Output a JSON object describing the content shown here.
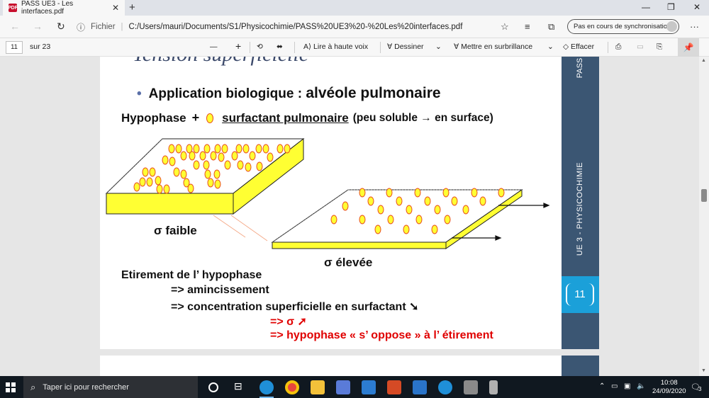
{
  "browser": {
    "tab_title": "PASS UE3 - Les interfaces.pdf",
    "tab_close": "✕",
    "new_tab": "+",
    "window_minimize": "—",
    "window_restore": "❐",
    "window_close": "✕",
    "url_scheme_label": "Fichier",
    "url_path": "C:/Users/mauri/Documents/S1/Physicochimie/PASS%20UE3%20-%20Les%20interfaces.pdf",
    "sync_label": "Pas en cours de synchronisation",
    "more_menu": "···"
  },
  "pdf_toolbar": {
    "current_page": "11",
    "page_total": "sur 23",
    "zoom_out": "—",
    "zoom_in": "+",
    "read_aloud": "Lire à haute voix",
    "draw": "Dessiner",
    "highlight": "Mettre en surbrillance",
    "erase": "Effacer"
  },
  "slide": {
    "title": "Tension superficielle",
    "bullet_prefix": "Application biologique : ",
    "bullet_main": "alvéole pulmonaire",
    "hypophase": "Hypophase",
    "plus": "+",
    "surfactant": "surfactant pulmonaire ",
    "surfactant_note": "(peu soluble → en surface)",
    "sigma_low": "σ faible",
    "sigma_high": "σ élevée",
    "stretch_title": "Etirement de l’ hypophase",
    "stretch_1": "=> amincissement",
    "stretch_2": "=> concentration superficielle en surfactant ➘",
    "stretch_3": "=> σ ➚",
    "stretch_4": "=> hypophase « s’ oppose » à l’ étirement",
    "band_top": "PASS",
    "band_course": "UE 3 - PHYSICOCHIMIE",
    "page_number": "11",
    "colors": {
      "band": "#3b5673",
      "band_accent": "#1ba0d9",
      "slab_yellow": "#ffff33",
      "emphasis_red": "#e00000"
    }
  },
  "taskbar": {
    "search_placeholder": "Taper ici pour rechercher",
    "time": "10:08",
    "date": "24/09/2020",
    "notification_count": "3"
  }
}
